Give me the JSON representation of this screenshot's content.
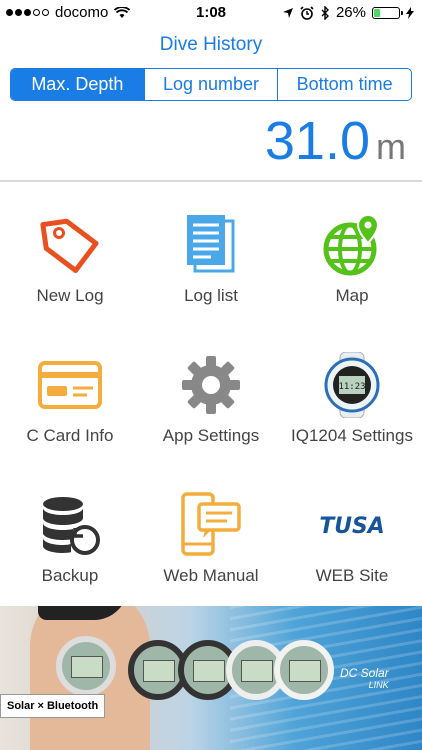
{
  "status_bar": {
    "carrier": "docomo",
    "time": "1:08",
    "battery_percent": "26%",
    "battery_level": 0.26
  },
  "nav": {
    "title": "Dive History"
  },
  "segments": [
    {
      "label": "Max. Depth",
      "active": true
    },
    {
      "label": "Log number",
      "active": false
    },
    {
      "label": "Bottom time",
      "active": false
    }
  ],
  "stat": {
    "value": "31.0",
    "unit": "m"
  },
  "menu": [
    {
      "label": "New Log",
      "icon": "tag-icon"
    },
    {
      "label": "Log list",
      "icon": "document-list-icon"
    },
    {
      "label": "Map",
      "icon": "globe-pin-icon"
    },
    {
      "label": "C Card Info",
      "icon": "card-icon"
    },
    {
      "label": "App Settings",
      "icon": "gear-icon"
    },
    {
      "label": "IQ1204 Settings",
      "icon": "dive-watch-icon"
    },
    {
      "label": "Backup",
      "icon": "database-restore-icon"
    },
    {
      "label": "Web Manual",
      "icon": "phone-chat-icon"
    },
    {
      "label": "WEB Site",
      "icon": "tusa-logo"
    }
  ],
  "logo_text": "TUSA",
  "banner": {
    "left_tag_solar": "Solar",
    "left_tag_x": "×",
    "left_tag_bt": "Bluetooth",
    "right_brand": "DC Solar",
    "right_brand_sub": "LINK"
  },
  "colors": {
    "accent": "#1a7ce5",
    "orange": "#e8511f",
    "green": "#55c21a",
    "amber": "#f4ad3c",
    "gray": "#777777"
  }
}
